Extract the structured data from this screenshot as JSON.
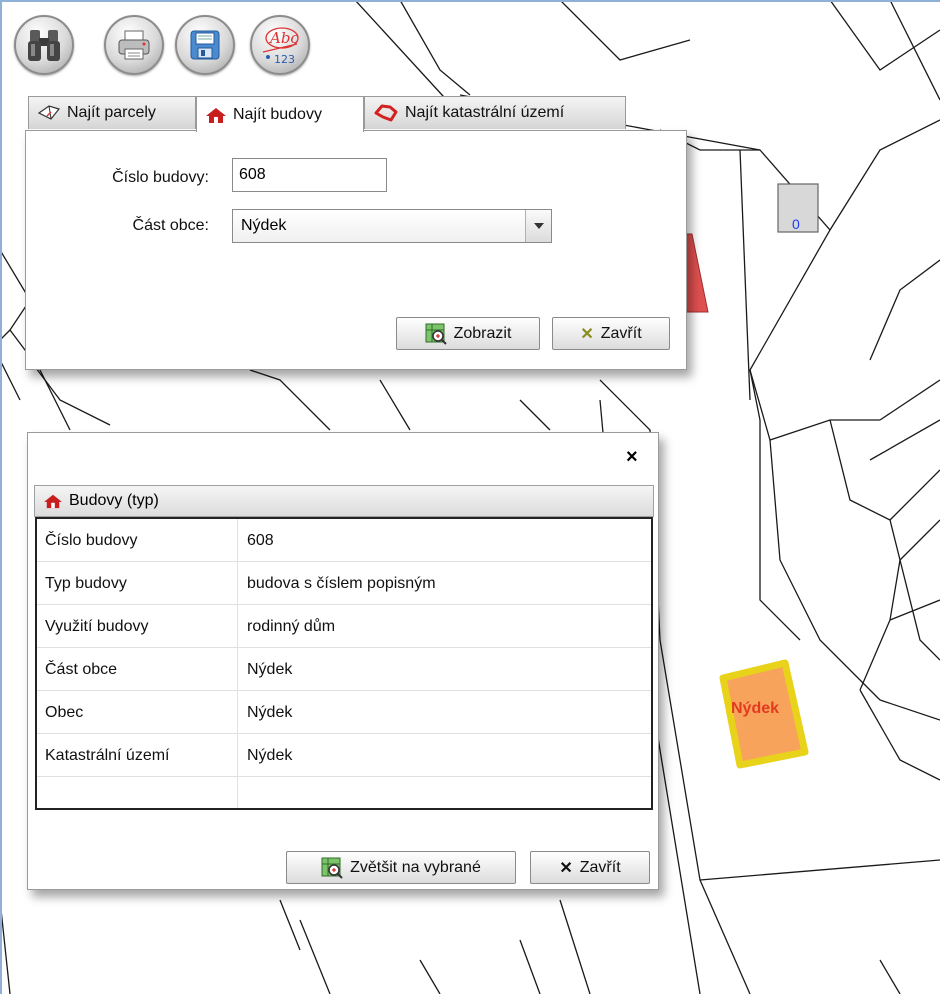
{
  "toolbar": {
    "icons": [
      "binoculars-icon",
      "printer-icon",
      "floppy-disk-icon",
      "abc-123-icon"
    ],
    "abc_text": "Abc",
    "num_text": "123"
  },
  "tabs": [
    {
      "label": "Najít parcely",
      "icon": "parcel-icon",
      "active": false
    },
    {
      "label": "Najít budovy",
      "icon": "house-icon",
      "active": true
    },
    {
      "label": "Najít katastrální území",
      "icon": "territory-icon",
      "active": false
    }
  ],
  "search_form": {
    "building_number_label": "Číslo budovy:",
    "building_number_value": "608",
    "municipality_part_label": "Část obce:",
    "municipality_part_value": "Nýdek",
    "show_button": "Zobrazit",
    "close_button": "Zavřít"
  },
  "result_dialog": {
    "close_glyph": "×",
    "group_title": "Budovy (typ)",
    "rows": [
      {
        "key": "Číslo budovy",
        "value": "608"
      },
      {
        "key": "Typ budovy",
        "value": "budova s číslem popisným"
      },
      {
        "key": "Využití budovy",
        "value": "rodinný dům"
      },
      {
        "key": "Část obce",
        "value": "Nýdek"
      },
      {
        "key": "Obec",
        "value": "Nýdek"
      },
      {
        "key": "Katastrální území",
        "value": "Nýdek"
      }
    ],
    "zoom_button": "Zvětšit na vybrané",
    "close_button": "Zavřít"
  },
  "map": {
    "building_number_label": "0",
    "highlight_label": "Nýdek",
    "highlight_fill": "#f7a35c",
    "highlight_border": "#e8d21a",
    "red_building_fill": "#e05050"
  },
  "colors": {
    "house_icon_red": "#c81e1e",
    "frame_blue": "#8fb0d8"
  }
}
